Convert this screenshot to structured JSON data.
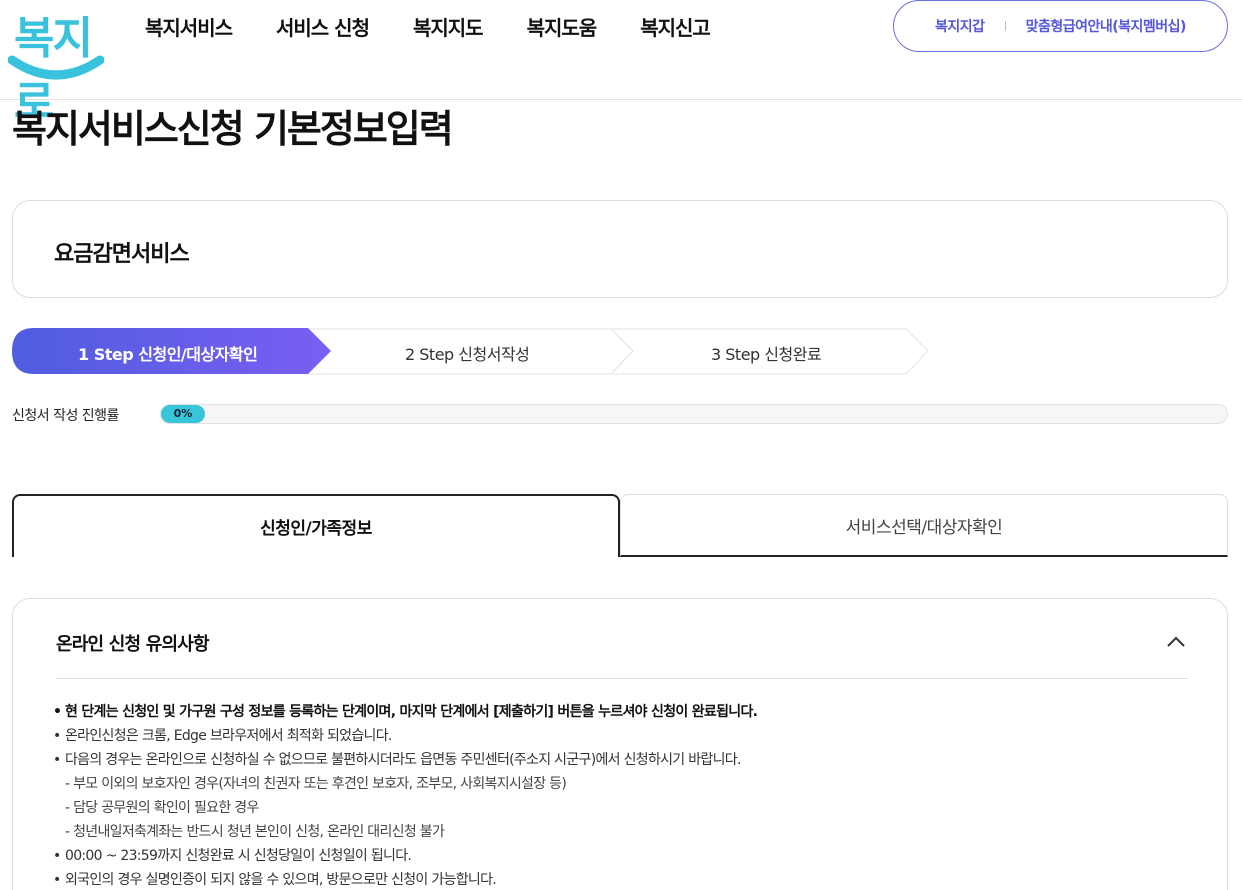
{
  "header": {
    "logo_text": "복지로",
    "nav": [
      "복지서비스",
      "서비스 신청",
      "복지지도",
      "복지도움",
      "복지신고"
    ],
    "util_links": [
      "복지지갑",
      "맞춤형급여안내(복지멤버십)"
    ],
    "brand_color": "#39c2dc",
    "accent_color": "#5558d8"
  },
  "page": {
    "title": "복지서비스신청 기본정보입력"
  },
  "service": {
    "name": "요금감면서비스"
  },
  "steps": [
    {
      "label": "1 Step 신청인/대상자확인",
      "active": true
    },
    {
      "label": "2 Step 신청서작성",
      "active": false
    },
    {
      "label": "3 Step 신청완료",
      "active": false
    }
  ],
  "progress": {
    "label": "신청서 작성 진행률",
    "value_text": "0%",
    "value": 0
  },
  "tabs": [
    {
      "label": "신청인/가족정보",
      "active": true
    },
    {
      "label": "서비스선택/대상자확인",
      "active": false
    }
  ],
  "notice": {
    "title": "온라인 신청 유의사항",
    "toggle_icon": "chevron-up-icon",
    "items": [
      {
        "text": "현 단계는 신청인 및 가구원 구성 정보를 등록하는 단계이며, 마지막 단계에서 [제출하기] 버튼을 누르셔야 신청이 완료됩니다.",
        "type": "bullet-bold"
      },
      {
        "text": "온라인신청은 크롬, Edge 브라우저에서 최적화 되었습니다.",
        "type": "bullet"
      },
      {
        "text": "다음의 경우는 온라인으로 신청하실 수 없으므로 불편하시더라도 읍면동 주민센터(주소지 시군구)에서 신청하시기 바랍니다.",
        "type": "bullet"
      },
      {
        "text": "- 부모 이외의 보호자인 경우(자녀의 친권자 또는 후견인 보호자, 조부모, 사회복지시설장 등)",
        "type": "sub"
      },
      {
        "text": "- 담당 공무원의 확인이 필요한 경우",
        "type": "sub"
      },
      {
        "text": "- 청년내일저축계좌는 반드시 청년 본인이 신청, 온라인 대리신청 불가",
        "type": "sub"
      },
      {
        "text": "00:00 ~ 23:59까지 신청완료 시 신청당일이 신청일이 됩니다.",
        "type": "bullet"
      },
      {
        "text": "외국인의 경우 실명인증이 되지 않을 수 있으며, 방문으로만 신청이 가능합니다.",
        "type": "bullet"
      }
    ]
  }
}
